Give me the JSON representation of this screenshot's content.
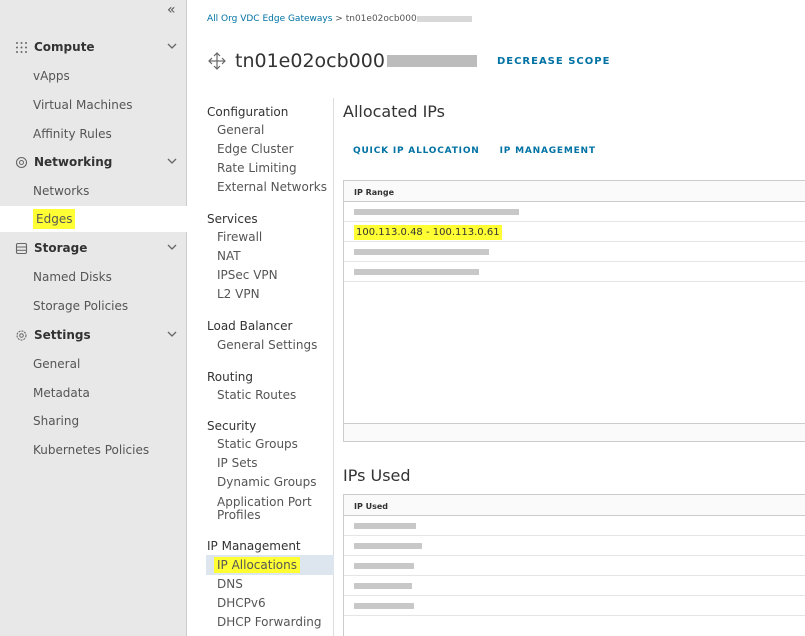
{
  "leftnav": {
    "collapse_glyph": "«",
    "groups": [
      {
        "label": "Compute",
        "icon": "grid-icon",
        "items": [
          "vApps",
          "Virtual Machines",
          "Affinity Rules"
        ]
      },
      {
        "label": "Networking",
        "icon": "network-icon",
        "items": [
          "Networks",
          "Edges"
        ]
      },
      {
        "label": "Storage",
        "icon": "storage-icon",
        "items": [
          "Named Disks",
          "Storage Policies"
        ]
      },
      {
        "label": "Settings",
        "icon": "gear-icon",
        "items": [
          "General",
          "Metadata",
          "Sharing",
          "Kubernetes Policies"
        ]
      }
    ],
    "active_item": "Edges"
  },
  "breadcrumb": {
    "root": "All Org VDC Edge Gateways",
    "separator": ">",
    "current": "tn01e02ocb000"
  },
  "header": {
    "title": "tn01e02ocb000",
    "scope_button": "DECREASE SCOPE"
  },
  "subnav": {
    "sections": [
      {
        "heading": "Configuration",
        "items": [
          "General",
          "Edge Cluster",
          "Rate Limiting",
          "External Networks"
        ]
      },
      {
        "heading": "Services",
        "items": [
          "Firewall",
          "NAT",
          "IPSec VPN",
          "L2 VPN"
        ]
      },
      {
        "heading": "Load Balancer",
        "items": [
          "General Settings"
        ]
      },
      {
        "heading": "Routing",
        "items": [
          "Static Routes"
        ]
      },
      {
        "heading": "Security",
        "items": [
          "Static Groups",
          "IP Sets",
          "Dynamic Groups",
          "Application Port Profiles"
        ]
      },
      {
        "heading": "IP Management",
        "items": [
          "IP Allocations",
          "DNS",
          "DHCPv6",
          "DHCP Forwarding"
        ]
      }
    ],
    "selected": "IP Allocations"
  },
  "allocated": {
    "title": "Allocated IPs",
    "tabs": [
      "QUICK IP ALLOCATION",
      "IP MANAGEMENT"
    ],
    "column": "IP Range",
    "highlighted_row": "100.113.0.48 - 100.113.0.61"
  },
  "used": {
    "title": "IPs Used",
    "column": "IP Used"
  },
  "colors": {
    "highlight": "#ffff33",
    "link": "#0072a3",
    "nav_bg": "#e8e8e8"
  }
}
